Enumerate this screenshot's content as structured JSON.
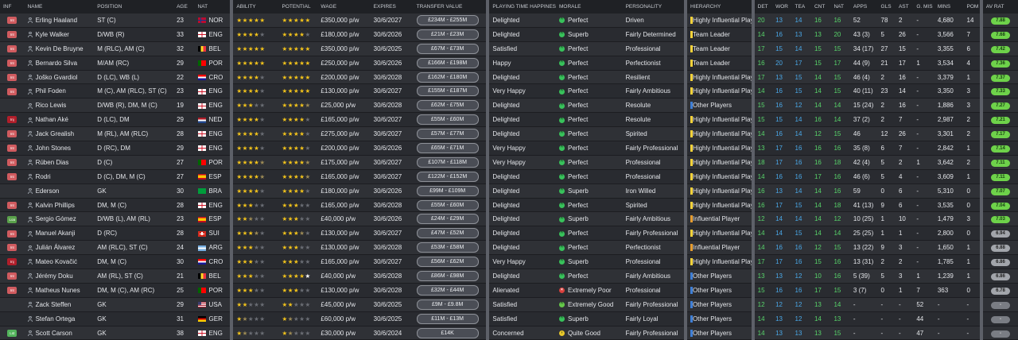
{
  "columns": [
    "INF",
    "NAME",
    "POSITION",
    "AGE",
    "NAT",
    "ABILITY",
    "POTENTIAL",
    "WAGE",
    "EXPIRES",
    "TRANSFER VALUE",
    "PLAYING TIME HAPPINESS",
    "MORALE",
    "PERSONALITY",
    "HIERARCHY",
    "DET",
    "WOR",
    "TEA",
    "CNT",
    "NAT",
    "APPS",
    "GLS",
    "AST",
    "G. MIS",
    "MINS",
    "POM",
    "AV RAT"
  ],
  "players": [
    {
      "inf": "Int",
      "name": "Erling Haaland",
      "pos": "ST (C)",
      "age": "23",
      "nat": "NOR",
      "ability": 5,
      "potential": 5,
      "wage": "£350,000 p/w",
      "expires": "30/6/2027",
      "value": "£234M - £255M",
      "pt": "Delighted",
      "morale": "Perfect",
      "mcls": "m-perfect",
      "personality": "Driven",
      "hierarchy": "Highly Influential Player",
      "hcls": "hier-hi",
      "det": "20",
      "wor": "13",
      "tea": "14",
      "cnt": "16",
      "nat2": "16",
      "apps": "52",
      "gls": "78",
      "ast": "2",
      "gmis": "-",
      "mins": "4,680",
      "pom": "14",
      "rat": "7.88",
      "rcls": "rat-hi"
    },
    {
      "inf": "Int",
      "name": "Kyle Walker",
      "pos": "D/WB (R)",
      "age": "33",
      "nat": "ENG",
      "ability": 4,
      "potential": 4,
      "wage": "£180,000 p/w",
      "expires": "30/6/2026",
      "value": "£21M - £23M",
      "pt": "Delighted",
      "morale": "Superb",
      "mcls": "m-superb",
      "personality": "Fairly Determined",
      "hierarchy": "Team Leader",
      "hcls": "hier-tl",
      "det": "14",
      "wor": "16",
      "tea": "13",
      "cnt": "13",
      "nat2": "20",
      "apps": "43 (3)",
      "gls": "5",
      "ast": "26",
      "gmis": "-",
      "mins": "3,566",
      "pom": "7",
      "rat": "7.68",
      "rcls": "rat-hi"
    },
    {
      "inf": "Int",
      "name": "Kevin De Bruyne",
      "pos": "M (RLC), AM (C)",
      "age": "32",
      "nat": "BEL",
      "ability": 5,
      "potential": 5,
      "wage": "£350,000 p/w",
      "expires": "30/6/2025",
      "value": "£67M - £73M",
      "pt": "Satisfied",
      "morale": "Perfect",
      "mcls": "m-perfect",
      "personality": "Professional",
      "hierarchy": "Team Leader",
      "hcls": "hier-tl",
      "det": "17",
      "wor": "15",
      "tea": "14",
      "cnt": "15",
      "nat2": "15",
      "apps": "34 (17)",
      "gls": "27",
      "ast": "15",
      "gmis": "-",
      "mins": "3,355",
      "pom": "6",
      "rat": "7.42",
      "rcls": "rat-hi"
    },
    {
      "inf": "Int",
      "name": "Bernardo Silva",
      "pos": "M/AM (RC)",
      "age": "29",
      "nat": "POR",
      "ability": 5,
      "potential": 5,
      "wage": "£250,000 p/w",
      "expires": "30/6/2026",
      "value": "£166M - £198M",
      "pt": "Happy",
      "morale": "Perfect",
      "mcls": "m-perfect",
      "personality": "Perfectionist",
      "hierarchy": "Team Leader",
      "hcls": "hier-tl",
      "det": "16",
      "wor": "20",
      "tea": "17",
      "cnt": "15",
      "nat2": "17",
      "apps": "44 (9)",
      "gls": "21",
      "ast": "17",
      "gmis": "1",
      "mins": "3,534",
      "pom": "4",
      "rat": "7.36",
      "rcls": "rat-hi"
    },
    {
      "inf": "Int",
      "name": "Joško Gvardiol",
      "pos": "D (LC), WB (L)",
      "age": "22",
      "nat": "CRO",
      "ability": 4,
      "potential": 5,
      "wage": "£200,000 p/w",
      "expires": "30/6/2028",
      "value": "£162M - £180M",
      "pt": "Delighted",
      "morale": "Perfect",
      "mcls": "m-perfect",
      "personality": "Resilient",
      "hierarchy": "Highly Influential Player",
      "hcls": "hier-hi",
      "det": "17",
      "wor": "13",
      "tea": "15",
      "cnt": "14",
      "nat2": "15",
      "apps": "46 (4)",
      "gls": "2",
      "ast": "16",
      "gmis": "-",
      "mins": "3,379",
      "pom": "1",
      "rat": "7.37",
      "rcls": "rat-hi"
    },
    {
      "inf": "Int",
      "name": "Phil Foden",
      "pos": "M (C), AM (RLC), ST (C)",
      "age": "23",
      "nat": "ENG",
      "ability": 4,
      "potential": 5,
      "wage": "£130,000 p/w",
      "expires": "30/6/2027",
      "value": "£155M - £187M",
      "pt": "Very Happy",
      "morale": "Perfect",
      "mcls": "m-perfect",
      "personality": "Fairly Ambitious",
      "hierarchy": "Highly Influential Player",
      "hcls": "hier-hi",
      "det": "14",
      "wor": "16",
      "tea": "15",
      "cnt": "14",
      "nat2": "15",
      "apps": "40 (11)",
      "gls": "23",
      "ast": "14",
      "gmis": "-",
      "mins": "3,350",
      "pom": "3",
      "rat": "7.33",
      "rcls": "rat-hi"
    },
    {
      "inf": "",
      "name": "Rico Lewis",
      "pos": "D/WB (R), DM, M (C)",
      "age": "19",
      "nat": "ENG",
      "ability": 3,
      "potential": 4.5,
      "wage": "£25,000 p/w",
      "expires": "30/6/2028",
      "value": "£62M - £75M",
      "pt": "Delighted",
      "morale": "Perfect",
      "mcls": "m-perfect",
      "personality": "Resolute",
      "hierarchy": "Other Players",
      "hcls": "hier-op",
      "det": "15",
      "wor": "16",
      "tea": "12",
      "cnt": "14",
      "nat2": "14",
      "apps": "15 (24)",
      "gls": "2",
      "ast": "16",
      "gmis": "-",
      "mins": "1,886",
      "pom": "3",
      "rat": "7.27",
      "rcls": "rat-hi"
    },
    {
      "inf": "Inj",
      "name": "Nathan Aké",
      "pos": "D (LC), DM",
      "age": "29",
      "nat": "NED",
      "ability": 4,
      "potential": 4,
      "wage": "£165,000 p/w",
      "expires": "30/6/2027",
      "value": "£55M - £60M",
      "pt": "Delighted",
      "morale": "Perfect",
      "mcls": "m-perfect",
      "personality": "Resolute",
      "hierarchy": "Highly Influential Player",
      "hcls": "hier-hi",
      "det": "15",
      "wor": "15",
      "tea": "14",
      "cnt": "16",
      "nat2": "14",
      "apps": "37 (2)",
      "gls": "2",
      "ast": "7",
      "gmis": "-",
      "mins": "2,987",
      "pom": "2",
      "rat": "7.21",
      "rcls": "rat-hi"
    },
    {
      "inf": "Int",
      "name": "Jack Grealish",
      "pos": "M (RL), AM (RLC)",
      "age": "28",
      "nat": "ENG",
      "ability": 4,
      "potential": 4,
      "wage": "£275,000 p/w",
      "expires": "30/6/2027",
      "value": "£57M - £77M",
      "pt": "Delighted",
      "morale": "Perfect",
      "mcls": "m-perfect",
      "personality": "Spirited",
      "hierarchy": "Highly Influential Player",
      "hcls": "hier-hi",
      "det": "14",
      "wor": "16",
      "tea": "14",
      "cnt": "12",
      "nat2": "15",
      "apps": "46",
      "gls": "12",
      "ast": "26",
      "gmis": "-",
      "mins": "3,301",
      "pom": "2",
      "rat": "7.17",
      "rcls": "rat-hi"
    },
    {
      "inf": "Int",
      "name": "John Stones",
      "pos": "D (RC), DM",
      "age": "29",
      "nat": "ENG",
      "ability": 4,
      "potential": 4,
      "wage": "£200,000 p/w",
      "expires": "30/6/2026",
      "value": "£65M - £71M",
      "pt": "Very Happy",
      "morale": "Perfect",
      "mcls": "m-perfect",
      "personality": "Fairly Professional",
      "hierarchy": "Highly Influential Player",
      "hcls": "hier-hi",
      "det": "13",
      "wor": "17",
      "tea": "16",
      "cnt": "16",
      "nat2": "16",
      "apps": "35 (8)",
      "gls": "6",
      "ast": "7",
      "gmis": "-",
      "mins": "2,842",
      "pom": "1",
      "rat": "7.14",
      "rcls": "rat-hi"
    },
    {
      "inf": "Int",
      "name": "Rúben Dias",
      "pos": "D (C)",
      "age": "27",
      "nat": "POR",
      "ability": 4.5,
      "potential": 4.5,
      "wage": "£175,000 p/w",
      "expires": "30/6/2027",
      "value": "£107M - £118M",
      "pt": "Very Happy",
      "morale": "Perfect",
      "mcls": "m-perfect",
      "personality": "Professional",
      "hierarchy": "Highly Influential Player",
      "hcls": "hier-hi",
      "det": "18",
      "wor": "17",
      "tea": "16",
      "cnt": "16",
      "nat2": "18",
      "apps": "42 (4)",
      "gls": "5",
      "ast": "2",
      "gmis": "1",
      "mins": "3,642",
      "pom": "2",
      "rat": "7.11",
      "rcls": "rat-hi"
    },
    {
      "inf": "Int",
      "name": "Rodri",
      "pos": "D (C), DM, M (C)",
      "age": "27",
      "nat": "ESP",
      "ability": 4.5,
      "potential": 4.5,
      "wage": "£165,000 p/w",
      "expires": "30/6/2027",
      "value": "£122M - £152M",
      "pt": "Delighted",
      "morale": "Perfect",
      "mcls": "m-perfect",
      "personality": "Professional",
      "hierarchy": "Highly Influential Player",
      "hcls": "hier-hi",
      "det": "14",
      "wor": "16",
      "tea": "16",
      "cnt": "17",
      "nat2": "16",
      "apps": "46 (6)",
      "gls": "5",
      "ast": "4",
      "gmis": "-",
      "mins": "3,609",
      "pom": "1",
      "rat": "7.11",
      "rcls": "rat-hi"
    },
    {
      "inf": "",
      "name": "Ederson",
      "pos": "GK",
      "age": "30",
      "nat": "BRA",
      "ability": 4,
      "potential": 4,
      "wage": "£180,000 p/w",
      "expires": "30/6/2026",
      "value": "£99M - £109M",
      "pt": "Delighted",
      "morale": "Superb",
      "mcls": "m-superb",
      "personality": "Iron Willed",
      "hierarchy": "Highly Influential Player",
      "hcls": "hier-hi",
      "det": "16",
      "wor": "13",
      "tea": "14",
      "cnt": "14",
      "nat2": "16",
      "apps": "59",
      "gls": "0",
      "ast": "6",
      "gmis": "-",
      "mins": "5,310",
      "pom": "0",
      "rat": "7.07",
      "rcls": "rat-hi"
    },
    {
      "inf": "Int",
      "name": "Kalvin Phillips",
      "pos": "DM, M (C)",
      "age": "28",
      "nat": "ENG",
      "ability": 3,
      "potential": 3,
      "wage": "£165,000 p/w",
      "expires": "30/6/2028",
      "value": "£55M - £60M",
      "pt": "Delighted",
      "morale": "Perfect",
      "mcls": "m-perfect",
      "personality": "Spirited",
      "hierarchy": "Highly Influential Player",
      "hcls": "hier-hi",
      "det": "16",
      "wor": "17",
      "tea": "15",
      "cnt": "14",
      "nat2": "18",
      "apps": "41 (13)",
      "gls": "9",
      "ast": "6",
      "gmis": "-",
      "mins": "3,535",
      "pom": "0",
      "rat": "7.04",
      "rcls": "rat-hi"
    },
    {
      "inf": "Loa",
      "name": "Sergio Gómez",
      "pos": "D/WB (L), AM (RL)",
      "age": "23",
      "nat": "ESP",
      "ability": 2.5,
      "potential": 3,
      "wage": "£40,000 p/w",
      "expires": "30/6/2026",
      "value": "£24M - £29M",
      "pt": "Delighted",
      "morale": "Superb",
      "mcls": "m-superb",
      "personality": "Fairly Ambitious",
      "hierarchy": "Influential Player",
      "hcls": "hier-ip",
      "det": "12",
      "wor": "14",
      "tea": "14",
      "cnt": "14",
      "nat2": "12",
      "apps": "10 (25)",
      "gls": "1",
      "ast": "10",
      "gmis": "-",
      "mins": "1,479",
      "pom": "3",
      "rat": "7.03",
      "rcls": "rat-hi"
    },
    {
      "inf": "Int",
      "name": "Manuel Akanji",
      "pos": "D (RC)",
      "age": "28",
      "nat": "SUI",
      "ability": 3.5,
      "potential": 3.5,
      "wage": "£130,000 p/w",
      "expires": "30/6/2027",
      "value": "£47M - £52M",
      "pt": "Delighted",
      "morale": "Perfect",
      "mcls": "m-perfect",
      "personality": "Fairly Professional",
      "hierarchy": "Highly Influential Player",
      "hcls": "hier-hi",
      "det": "14",
      "wor": "14",
      "tea": "15",
      "cnt": "14",
      "nat2": "14",
      "apps": "25 (25)",
      "gls": "1",
      "ast": "1",
      "gmis": "-",
      "mins": "2,800",
      "pom": "0",
      "rat": "6.94",
      "rcls": "rat-mid"
    },
    {
      "inf": "Int",
      "name": "Julián Álvarez",
      "pos": "AM (RLC), ST (C)",
      "age": "24",
      "nat": "ARG",
      "ability": 3,
      "potential": 3,
      "wage": "£130,000 p/w",
      "expires": "30/6/2028",
      "value": "£53M - £58M",
      "pt": "Delighted",
      "morale": "Perfect",
      "mcls": "m-perfect",
      "personality": "Perfectionist",
      "hierarchy": "Influential Player",
      "hcls": "hier-ip",
      "det": "14",
      "wor": "16",
      "tea": "16",
      "cnt": "12",
      "nat2": "15",
      "apps": "13 (22)",
      "gls": "9",
      "ast": "3",
      "gmis": "-",
      "mins": "1,650",
      "pom": "1",
      "rat": "6.88",
      "rcls": "rat-mid"
    },
    {
      "inf": "Inj",
      "name": "Mateo Kovačić",
      "pos": "DM, M (C)",
      "age": "30",
      "nat": "CRO",
      "ability": 3,
      "potential": 3,
      "wage": "£165,000 p/w",
      "expires": "30/6/2027",
      "value": "£56M - £62M",
      "pt": "Very Happy",
      "morale": "Superb",
      "mcls": "m-superb",
      "personality": "Professional",
      "hierarchy": "Highly Influential Player",
      "hcls": "hier-hi",
      "det": "17",
      "wor": "17",
      "tea": "16",
      "cnt": "15",
      "nat2": "16",
      "apps": "13 (31)",
      "gls": "2",
      "ast": "2",
      "gmis": "-",
      "mins": "1,785",
      "pom": "1",
      "rat": "6.86",
      "rcls": "rat-mid"
    },
    {
      "inf": "Int",
      "name": "Jérémy Doku",
      "pos": "AM (RL), ST (C)",
      "age": "21",
      "nat": "BEL",
      "ability": 3,
      "potential": 4,
      "wage": "£40,000 p/w",
      "expires": "30/6/2028",
      "value": "£86M - £98M",
      "pt": "Delighted",
      "morale": "Perfect",
      "mcls": "m-perfect",
      "personality": "Fairly Ambitious",
      "hierarchy": "Other Players",
      "hcls": "hier-op",
      "det": "13",
      "wor": "13",
      "tea": "12",
      "cnt": "10",
      "nat2": "16",
      "apps": "5 (39)",
      "gls": "5",
      "ast": "3",
      "gmis": "1",
      "mins": "1,239",
      "pom": "1",
      "rat": "6.86",
      "rcls": "rat-mid"
    },
    {
      "inf": "Int",
      "name": "Matheus Nunes",
      "pos": "DM, M (C), AM (RC)",
      "age": "25",
      "nat": "POR",
      "ability": 3,
      "potential": 3,
      "wage": "£130,000 p/w",
      "expires": "30/6/2028",
      "value": "£32M - £44M",
      "pt": "Alienated",
      "morale": "Extremely Poor",
      "mcls": "m-ep",
      "personality": "Professional",
      "hierarchy": "Other Players",
      "hcls": "hier-op",
      "det": "15",
      "wor": "16",
      "tea": "16",
      "cnt": "17",
      "nat2": "15",
      "apps": "3 (7)",
      "gls": "0",
      "ast": "1",
      "gmis": "7",
      "mins": "363",
      "pom": "0",
      "rat": "6.78",
      "rcls": "rat-mid"
    },
    {
      "inf": "",
      "name": "Zack Steffen",
      "pos": "GK",
      "age": "29",
      "nat": "USA",
      "ability": 2,
      "potential": 2,
      "wage": "£45,000 p/w",
      "expires": "30/6/2025",
      "value": "£9M - £9.8M",
      "pt": "Satisfied",
      "morale": "Extremely Good",
      "mcls": "m-eg",
      "personality": "Fairly Professional",
      "hierarchy": "Other Players",
      "hcls": "hier-op",
      "det": "12",
      "wor": "12",
      "tea": "12",
      "cnt": "13",
      "nat2": "14",
      "apps": "-",
      "gls": "-",
      "ast": "-",
      "gmis": "52",
      "mins": "-",
      "pom": "-",
      "rat": "-",
      "rcls": "rat-na"
    },
    {
      "inf": "",
      "name": "Stefan Ortega",
      "pos": "GK",
      "age": "31",
      "nat": "GER",
      "ability": 1.5,
      "potential": 1.5,
      "wage": "£60,000 p/w",
      "expires": "30/6/2025",
      "value": "£11M - £13M",
      "pt": "Satisfied",
      "morale": "Superb",
      "mcls": "m-superb",
      "personality": "Fairly Loyal",
      "hierarchy": "Other Players",
      "hcls": "hier-op",
      "det": "14",
      "wor": "13",
      "tea": "12",
      "cnt": "14",
      "nat2": "13",
      "apps": "-",
      "gls": "-",
      "ast": "-",
      "gmis": "44",
      "mins": "-",
      "pom": "-",
      "rat": "-",
      "rcls": "rat-na"
    },
    {
      "inf": "Lst",
      "name": "Scott Carson",
      "pos": "GK",
      "age": "38",
      "nat": "ENG",
      "ability": 1.5,
      "potential": 1.5,
      "wage": "£30,000 p/w",
      "expires": "30/6/2024",
      "value": "£14K",
      "pt": "Concerned",
      "morale": "Quite Good",
      "mcls": "m-qg",
      "personality": "Fairly Professional",
      "hierarchy": "Other Players",
      "hcls": "hier-op",
      "det": "14",
      "wor": "13",
      "tea": "13",
      "cnt": "13",
      "nat2": "15",
      "apps": "-",
      "gls": "-",
      "ast": "-",
      "gmis": "47",
      "mins": "-",
      "pom": "-",
      "rat": "-",
      "rcls": "rat-na"
    }
  ]
}
